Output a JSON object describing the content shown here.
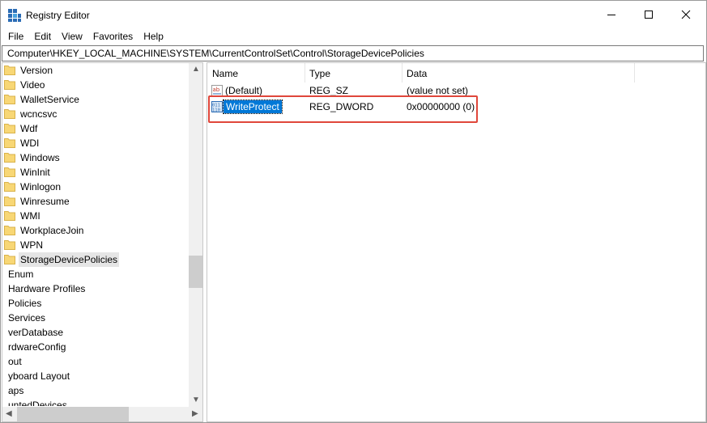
{
  "window": {
    "title": "Registry Editor",
    "controls": {
      "minimize": "─",
      "maximize": "☐",
      "close": "✕"
    }
  },
  "menu": [
    "File",
    "Edit",
    "View",
    "Favorites",
    "Help"
  ],
  "address": "Computer\\HKEY_LOCAL_MACHINE\\SYSTEM\\CurrentControlSet\\Control\\StorageDevicePolicies",
  "tree": {
    "items": [
      {
        "label": "Version",
        "folder": true
      },
      {
        "label": "Video",
        "folder": true
      },
      {
        "label": "WalletService",
        "folder": true
      },
      {
        "label": "wcncsvc",
        "folder": true
      },
      {
        "label": "Wdf",
        "folder": true
      },
      {
        "label": "WDI",
        "folder": true
      },
      {
        "label": "Windows",
        "folder": true
      },
      {
        "label": "WinInit",
        "folder": true
      },
      {
        "label": "Winlogon",
        "folder": true
      },
      {
        "label": "Winresume",
        "folder": true
      },
      {
        "label": "WMI",
        "folder": true
      },
      {
        "label": "WorkplaceJoin",
        "folder": true
      },
      {
        "label": "WPN",
        "folder": true
      },
      {
        "label": "StorageDevicePolicies",
        "folder": true,
        "selected": true
      },
      {
        "label": "Enum",
        "folder": false
      },
      {
        "label": "Hardware Profiles",
        "folder": false
      },
      {
        "label": "Policies",
        "folder": false
      },
      {
        "label": "Services",
        "folder": false
      },
      {
        "label": "verDatabase",
        "folder": false
      },
      {
        "label": "rdwareConfig",
        "folder": false
      },
      {
        "label": "out",
        "folder": false
      },
      {
        "label": "yboard Layout",
        "folder": false
      },
      {
        "label": "aps",
        "folder": false
      },
      {
        "label": "untedDevices",
        "folder": false
      }
    ]
  },
  "list": {
    "columns": [
      "Name",
      "Type",
      "Data"
    ],
    "rows": [
      {
        "name": "(Default)",
        "type": "REG_SZ",
        "data": "(value not set)",
        "icon": "string-value-icon"
      },
      {
        "name": "WriteProtect",
        "type": "REG_DWORD",
        "data": "0x00000000 (0)",
        "icon": "dword-value-icon",
        "selected": true
      }
    ]
  },
  "colors": {
    "selection": "#0078d7",
    "highlight_box": "#e0473b",
    "folder": "#f8d775"
  }
}
